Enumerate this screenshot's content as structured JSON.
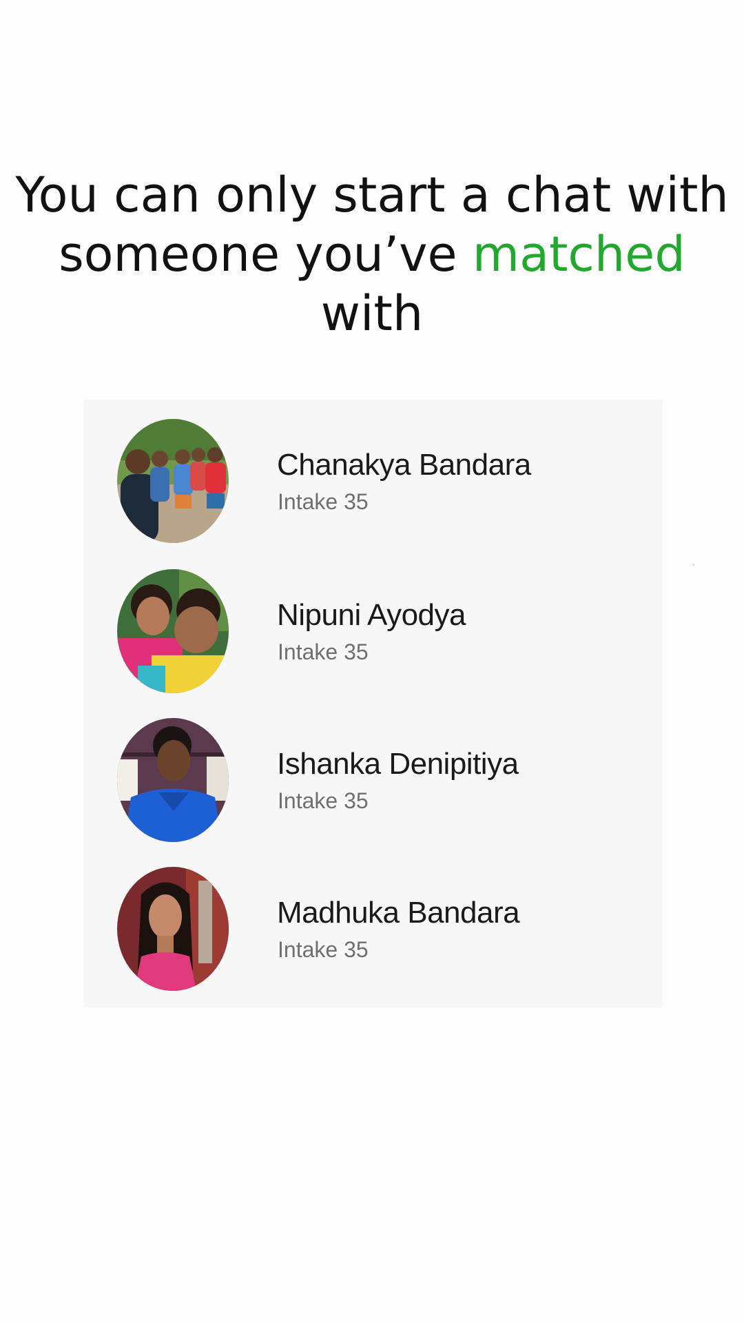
{
  "headline": {
    "line1": "You can only start a chat with",
    "line2_before": "someone you’ve ",
    "line2_accent": "matched",
    "line2_after": " with",
    "accent_color": "#23a82f"
  },
  "matches": [
    {
      "name": "Chanakya Bandara",
      "subtitle": "Intake 35",
      "avatar": "group-photo-avatar"
    },
    {
      "name": "Nipuni Ayodya",
      "subtitle": "Intake 35",
      "avatar": "two-friends-photo-avatar"
    },
    {
      "name": "Ishanka Denipitiya",
      "subtitle": "Intake 35",
      "avatar": "portrait-blue-shirt-avatar"
    },
    {
      "name": "Madhuka Bandara",
      "subtitle": "Intake 35",
      "avatar": "portrait-pink-top-avatar"
    }
  ]
}
